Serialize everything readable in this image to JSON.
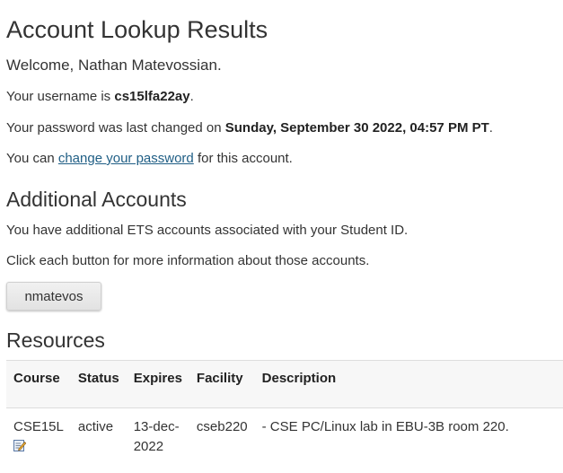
{
  "page_title": "Account Lookup Results",
  "welcome": "Welcome, Nathan Matevossian.",
  "username_line": {
    "prefix": "Your username is ",
    "value": "cs15lfa22ay",
    "suffix": "."
  },
  "password_line": {
    "prefix": "Your password was last changed on ",
    "value": "Sunday, September 30 2022, 04:57 PM PT",
    "suffix": "."
  },
  "change_password_line": {
    "prefix": "You can ",
    "link_text": "change your password",
    "suffix": " for this account."
  },
  "additional_accounts": {
    "heading": "Additional Accounts",
    "text1": "You have additional ETS accounts associated with your Student ID.",
    "text2": "Click each button for more information about those accounts.",
    "accounts": [
      "nmatevos"
    ]
  },
  "resources": {
    "heading": "Resources",
    "columns": [
      "Course",
      "Status",
      "Expires",
      "Facility",
      "Description"
    ],
    "rows": [
      {
        "course": "CSE15L",
        "status": "active",
        "expires_line1": "13-dec-",
        "expires_line2": "2022",
        "facility": "cseb220",
        "description": "- CSE PC/Linux lab in EBU-3B room 220.",
        "icon": "edit-icon"
      }
    ]
  },
  "colors": {
    "text": "#333333",
    "link": "#1f5e85",
    "table_header_bg": "#f7f7f7",
    "border": "#dddddd"
  }
}
